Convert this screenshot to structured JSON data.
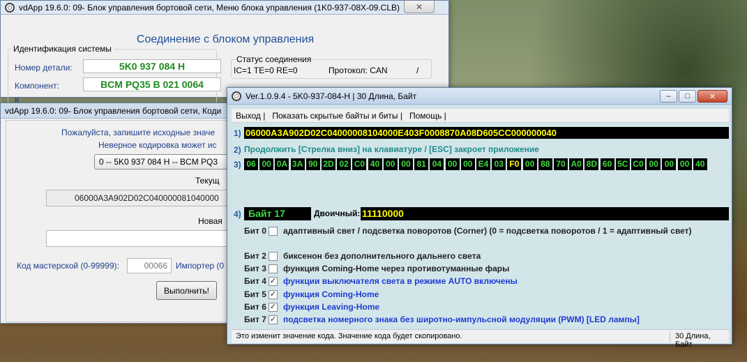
{
  "win1": {
    "title": "vdApp 19.6.0: 09- Блок управления бортовой сети,  Меню блока управления (1K0-937-08X-09.CLB)",
    "heading": "Соединение с блоком управления",
    "ident_group": "Идентификация системы",
    "part_label": "Номер детали:",
    "part_value": "5K0 937 084 H",
    "component_label": "Компонент:",
    "component_value": "BCM PQ35 B     021 0064",
    "coding_label": "К",
    "status_group": "Статус соединения",
    "status_ic": "IC=1  TE=0   RE=0",
    "status_protocol": "Протокол: CAN",
    "status_slash": "/"
  },
  "win2": {
    "title": "vdApp 19.6.0: 09- Блок управления бортовой сети,  Коди",
    "note1": "Пожалуйста, запишите исходные значе",
    "note2": "Неверное кодировка может ис",
    "select_value": "0 -- 5K0 937 084 H -- BCM PQ3",
    "current_label": "Текущ",
    "current_code": "06000A3A902D02C040000081040000",
    "new_label": "Новая",
    "new_code": "",
    "workshop_label": "Код мастерской (0-99999):",
    "workshop_value": "00066",
    "importer_label": "Импортер (0",
    "execute_button": "Выполнить!"
  },
  "win3": {
    "title": "Ver.1.0.9.4 -    5K0-937-084-H | 30 Длина, Байт",
    "menu": [
      "Выход |",
      "Показать скрытые байты и биты |",
      "Помощь |"
    ],
    "row1_num": "1)",
    "row1_code": "06000A3A902D02C04000008104000E403F0008870A08D605CC000000040",
    "row2_num": "2)",
    "row2_hint": "Продолжить [Стрелка вниз] на клавиатуре / [ESC] закроет приложение",
    "row3_num": "3)",
    "bytes": [
      "06",
      "00",
      "0A",
      "3A",
      "90",
      "2D",
      "02",
      "C0",
      "40",
      "00",
      "00",
      "81",
      "04",
      "00",
      "00",
      "E4",
      "03",
      "F0",
      "00",
      "88",
      "70",
      "A0",
      "8D",
      "60",
      "5C",
      "C0",
      "00",
      "00",
      "00",
      "40"
    ],
    "highlight_index": 17,
    "row4_num": "4)",
    "byte_label": "Байт 17",
    "binary_label": "Двоичный:",
    "binary_value": "11110000",
    "bits": [
      {
        "name": "Бит 0",
        "checked": false,
        "desc": "адаптивный свет / подсветка поворотов (Corner) (0 = подсветка поворотов / 1 = адаптивный свет)",
        "blue": false
      },
      {
        "name": "Бит 2",
        "checked": false,
        "desc": "биксенон без дополнительного дальнего света",
        "blue": false
      },
      {
        "name": "Бит 3",
        "checked": false,
        "desc": "функция Coming-Home через противотуманные фары",
        "blue": false
      },
      {
        "name": "Бит 4",
        "checked": true,
        "desc": "функции выключателя света в режиме AUTO включены",
        "blue": true
      },
      {
        "name": "Бит 5",
        "checked": true,
        "desc": "функция Coming-Home",
        "blue": true
      },
      {
        "name": "Бит 6",
        "checked": true,
        "desc": "функция Leaving-Home",
        "blue": true
      },
      {
        "name": "Бит 7",
        "checked": true,
        "desc": "подсветка номерного знака без широтно-импульсной модуляции (PWM) [LED лампы]",
        "blue": true
      }
    ],
    "status_left": "Это изменит значение кода.  Значение кода будет скопировано.",
    "status_right": "30 Длина, Байт"
  }
}
